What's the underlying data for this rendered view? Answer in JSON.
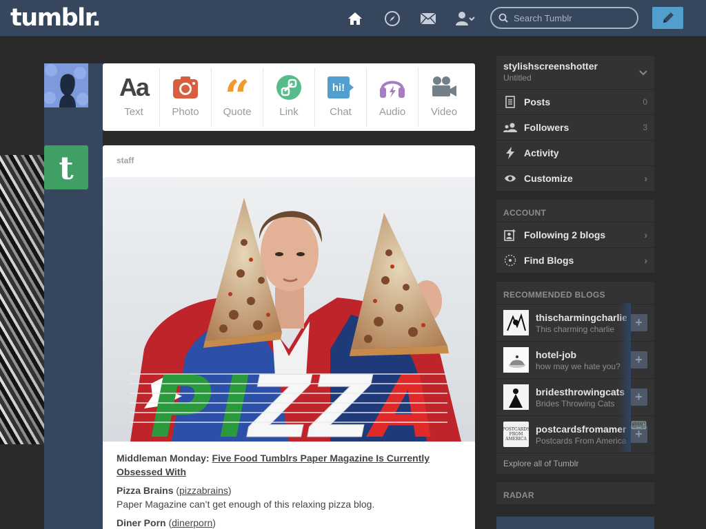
{
  "header": {
    "logo": "tumblr.",
    "search_placeholder": "Search Tumblr",
    "nav_icons": [
      "home-icon",
      "explore-icon",
      "inbox-icon",
      "account-icon"
    ],
    "compose_icon": "pencil-icon"
  },
  "post_types": [
    {
      "label": "Text",
      "icon": "text-icon",
      "color": "#444444"
    },
    {
      "label": "Photo",
      "icon": "camera-icon",
      "color": "#d95e40"
    },
    {
      "label": "Quote",
      "icon": "quote-icon",
      "color": "#f2992e"
    },
    {
      "label": "Link",
      "icon": "link-icon",
      "color": "#56bc8a"
    },
    {
      "label": "Chat",
      "icon": "chat-icon",
      "color": "#529ecc"
    },
    {
      "label": "Audio",
      "icon": "audio-icon",
      "color": "#a77dc2"
    },
    {
      "label": "Video",
      "icon": "video-icon",
      "color": "#748089"
    }
  ],
  "post": {
    "blog_name": "staff",
    "image_text": "PIZZA",
    "caption": {
      "prefix": "Middleman Monday: ",
      "link_text": "Five Food Tumblrs Paper Magazine Is Currently Obsessed With",
      "items": [
        {
          "name": "Pizza Brains",
          "open": " (",
          "link": "pizzabrains",
          "close": ")",
          "desc": "Paper Magazine can’t get enough of this relaxing pizza blog."
        },
        {
          "name": "Diner Porn",
          "open": " (",
          "link": "dinerporn",
          "close": ")",
          "desc": ""
        }
      ]
    }
  },
  "sidebar": {
    "blog": {
      "name": "stylishscreenshotter",
      "subtitle": "Untitled"
    },
    "items": [
      {
        "label": "Posts",
        "count": "0",
        "icon": "posts-icon"
      },
      {
        "label": "Followers",
        "count": "3",
        "icon": "followers-icon"
      },
      {
        "label": "Activity",
        "count": "",
        "icon": "activity-icon"
      },
      {
        "label": "Customize",
        "count": "",
        "icon": "eye-icon"
      }
    ],
    "account_heading": "ACCOUNT",
    "account_items": [
      {
        "label": "Following 2 blogs",
        "icon": "following-icon"
      },
      {
        "label": "Find Blogs",
        "icon": "find-blogs-icon"
      }
    ],
    "recommended_heading": "RECOMMENDED BLOGS",
    "recommended": [
      {
        "name": "thischarmingcharlie",
        "desc": "This charming charlie"
      },
      {
        "name": "hotel-job",
        "desc": "how may we hate you?"
      },
      {
        "name": "bridesthrowingcats",
        "desc": "Brides Throwing Cats"
      },
      {
        "name": "postcardsfromamerica",
        "desc": "Postcards From America",
        "thumb_text": "POSTCARDS FROM AMERICA"
      }
    ],
    "explore": "Explore all of Tumblr",
    "radar_heading": "RADAR"
  }
}
